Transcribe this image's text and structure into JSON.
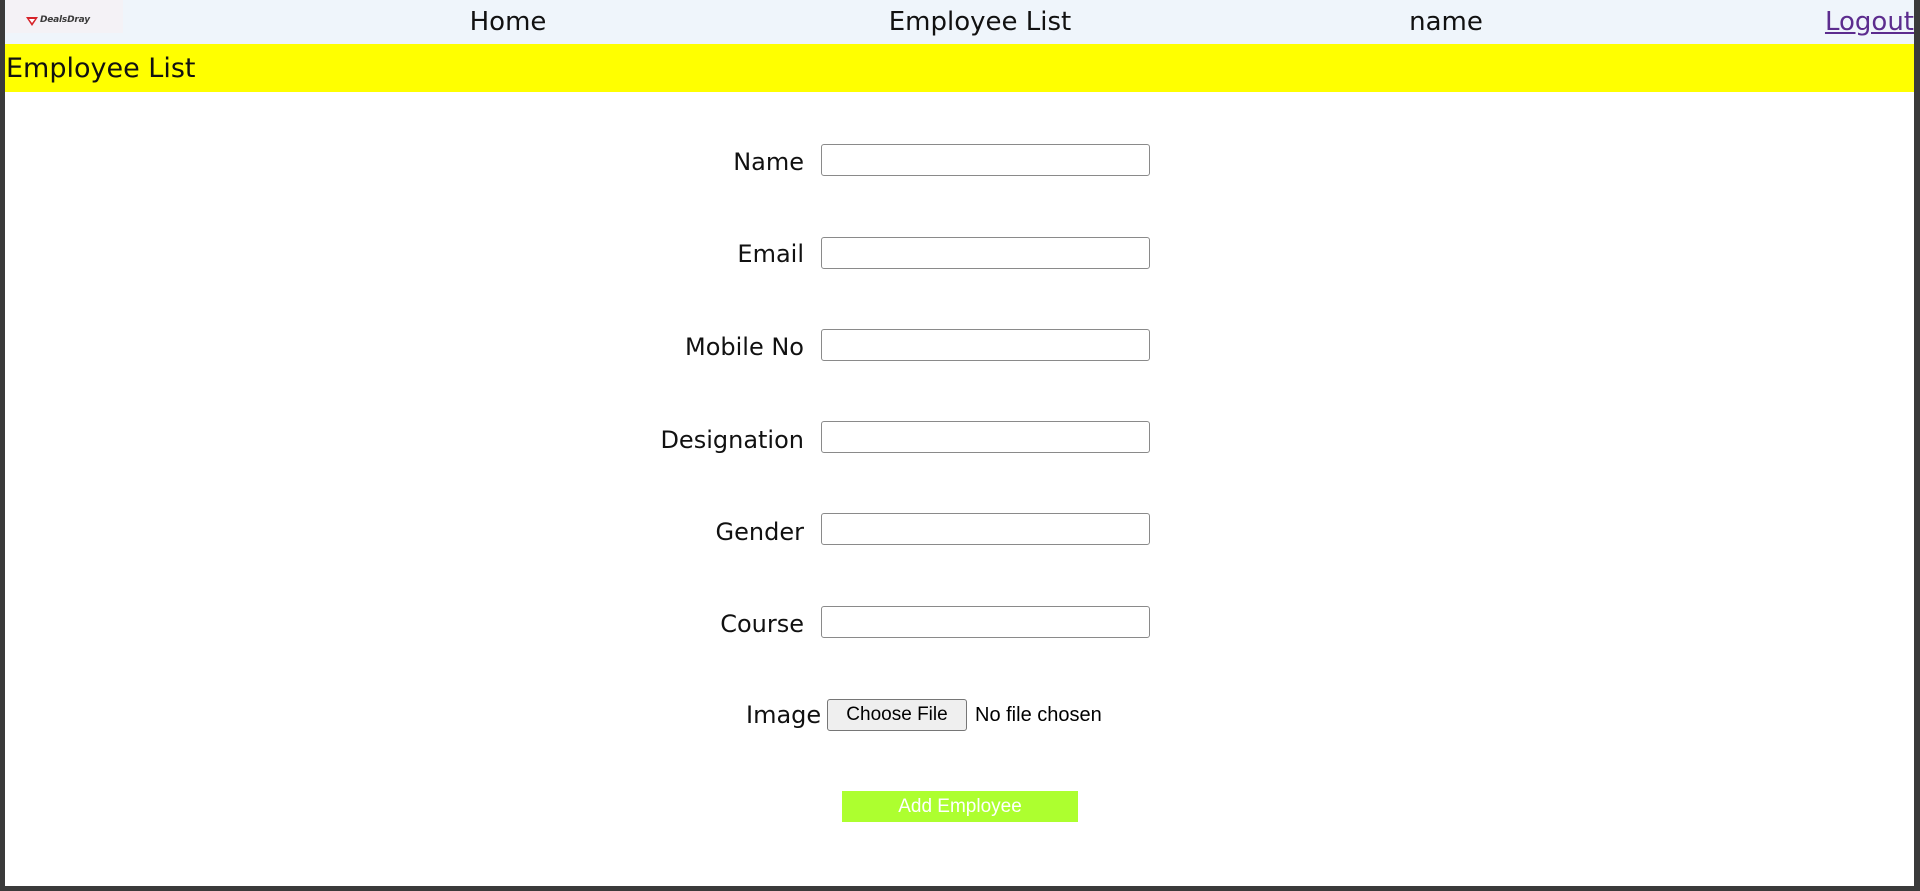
{
  "navbar": {
    "logo_text": "DealsDray",
    "links": [
      "Home",
      "Employee List",
      "name"
    ],
    "logout_label": "Logout"
  },
  "banner": {
    "title": "Employee List"
  },
  "form": {
    "fields": [
      {
        "label": "Name",
        "value": ""
      },
      {
        "label": "Email",
        "value": ""
      },
      {
        "label": "Mobile No",
        "value": ""
      },
      {
        "label": "Designation",
        "value": ""
      },
      {
        "label": "Gender",
        "value": ""
      },
      {
        "label": "Course",
        "value": ""
      }
    ],
    "image_label": "Image",
    "file_button_label": "Choose File",
    "file_status": "No file chosen",
    "submit_label": "Add Employee"
  },
  "colors": {
    "navbar_bg": "#eff5fb",
    "banner_bg": "#ffff00",
    "submit_bg": "#adff2f",
    "logout_link": "#5c2c8e",
    "logo_mark": "#d6232a"
  }
}
